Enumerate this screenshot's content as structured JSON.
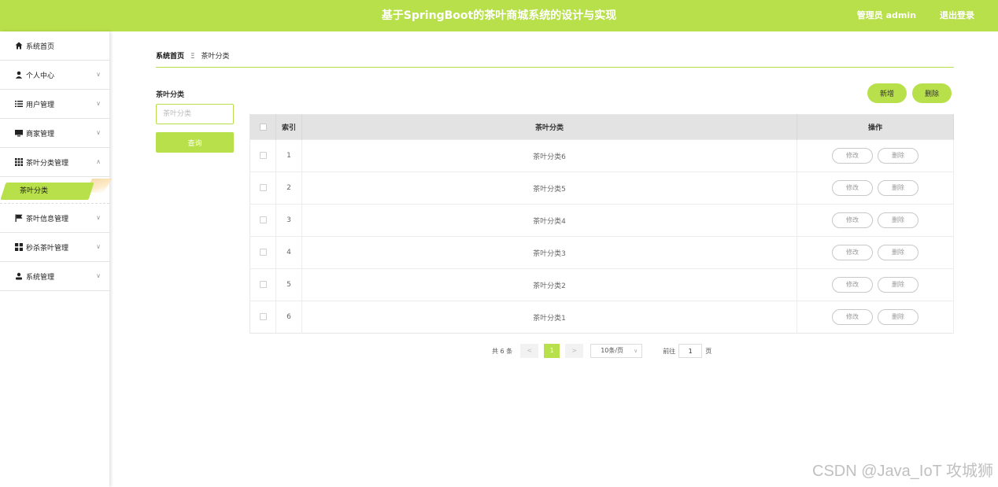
{
  "header": {
    "title": "基于SpringBoot的茶叶商城系统的设计与实现",
    "user": "管理员 admin",
    "logout": "退出登录"
  },
  "sidebar": {
    "items": [
      {
        "label": "系统首页",
        "icon": "home-icon"
      },
      {
        "label": "个人中心",
        "icon": "user-icon"
      },
      {
        "label": "用户管理",
        "icon": "list-icon"
      },
      {
        "label": "商家管理",
        "icon": "monitor-icon"
      },
      {
        "label": "茶叶分类管理",
        "icon": "grid-icon"
      },
      {
        "label": "茶叶信息管理",
        "icon": "flag-icon"
      },
      {
        "label": "秒杀茶叶管理",
        "icon": "apps-icon"
      },
      {
        "label": "系统管理",
        "icon": "admin-icon"
      }
    ],
    "active_sub": "茶叶分类"
  },
  "breadcrumb": {
    "home": "系统首页",
    "sep": "Ξ",
    "current": "茶叶分类"
  },
  "search": {
    "label": "茶叶分类",
    "placeholder": "茶叶分类",
    "button": "查询"
  },
  "actions": {
    "add": "新增",
    "delete": "删除"
  },
  "table": {
    "headers": {
      "index": "索引",
      "category": "茶叶分类",
      "ops": "操作"
    },
    "rows": [
      {
        "index": "1",
        "category": "茶叶分类6"
      },
      {
        "index": "2",
        "category": "茶叶分类5"
      },
      {
        "index": "3",
        "category": "茶叶分类4"
      },
      {
        "index": "4",
        "category": "茶叶分类3"
      },
      {
        "index": "5",
        "category": "茶叶分类2"
      },
      {
        "index": "6",
        "category": "茶叶分类1"
      }
    ],
    "edit_label": "修改",
    "delete_label": "删除"
  },
  "pagination": {
    "total": "共 6 条",
    "prev": "<",
    "current": "1",
    "next": ">",
    "page_size": "10条/页",
    "goto": "前往",
    "goto_value": "1",
    "page_suffix": "页"
  },
  "watermark": "CSDN @Java_IoT 攻城狮",
  "colors": {
    "accent": "#b8e04a"
  }
}
